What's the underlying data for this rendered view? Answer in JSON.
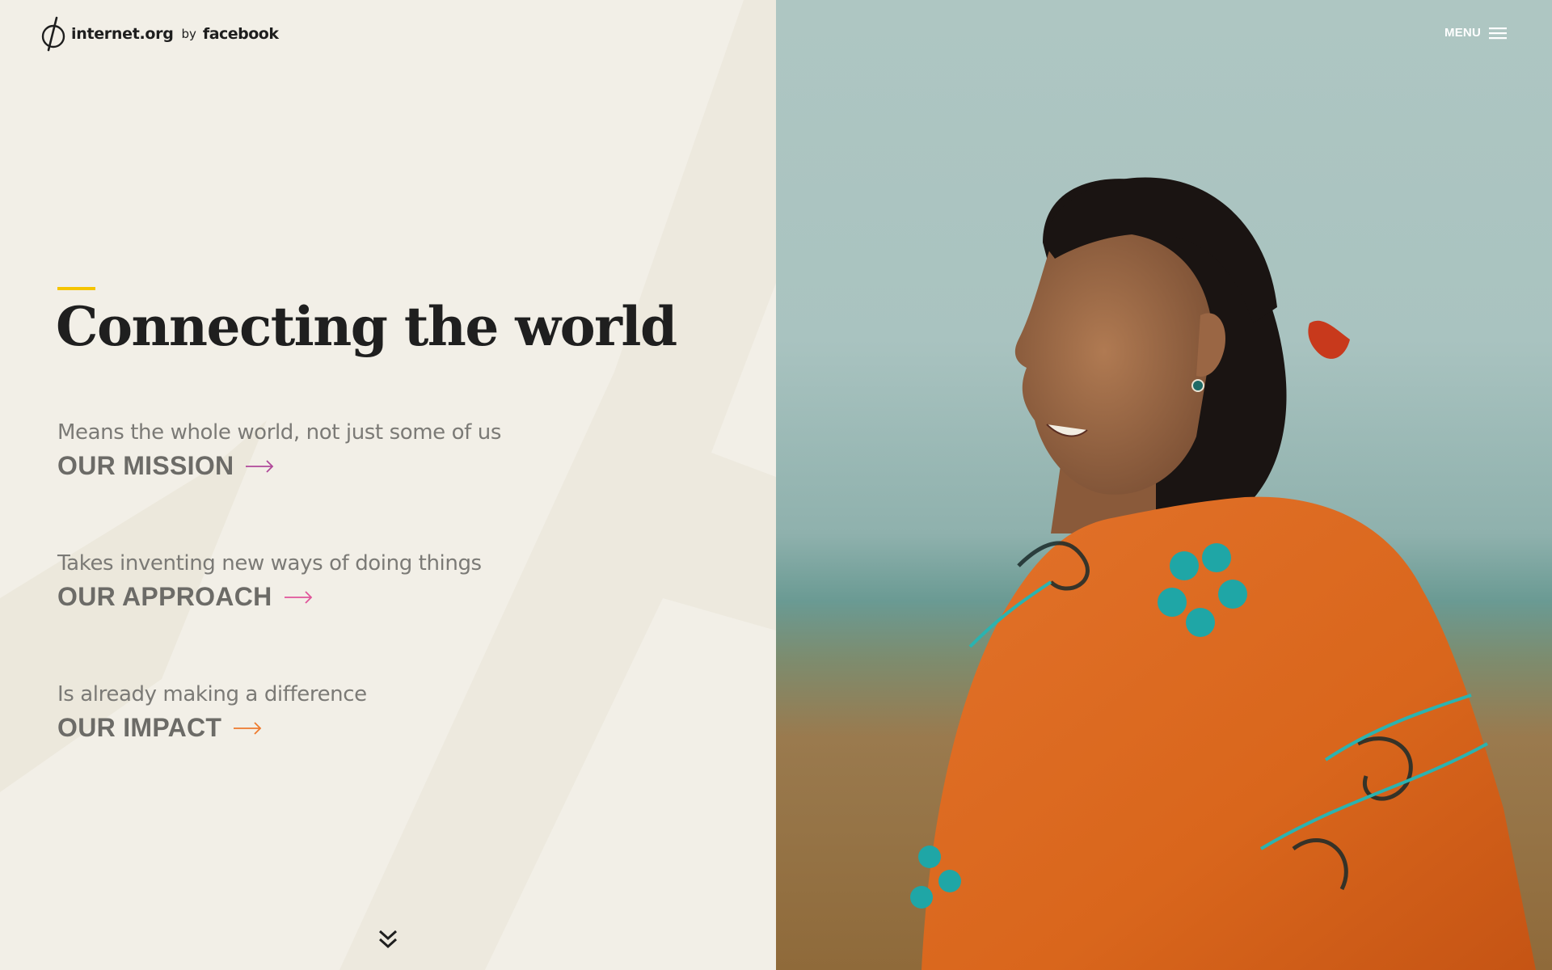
{
  "header": {
    "logo_text": "internet.org",
    "logo_by": "by",
    "logo_brand": "facebook",
    "menu_label": "MENU"
  },
  "hero": {
    "headline": "Connecting the world",
    "accent_color": "#f5c400"
  },
  "sections": [
    {
      "subtitle": "Means the whole world, not just some of us",
      "cta": "OUR MISSION",
      "arrow_color": "#b0489a"
    },
    {
      "subtitle": "Takes inventing new ways of doing things",
      "cta": "OUR APPROACH",
      "arrow_color": "#e0559a"
    },
    {
      "subtitle": "Is already making a difference",
      "cta": "OUR IMPACT",
      "arrow_color": "#ee7a2e"
    }
  ],
  "icons": {
    "logo": "internet-org-logo-icon",
    "menu": "hamburger-icon",
    "arrow": "arrow-right-icon",
    "scroll": "double-chevron-down-icon"
  },
  "image": {
    "subject": "smiling woman wrapped in orange embroidered shawl",
    "shawl_color": "#d9661c",
    "embroidery_color": "#1fa6a6"
  }
}
